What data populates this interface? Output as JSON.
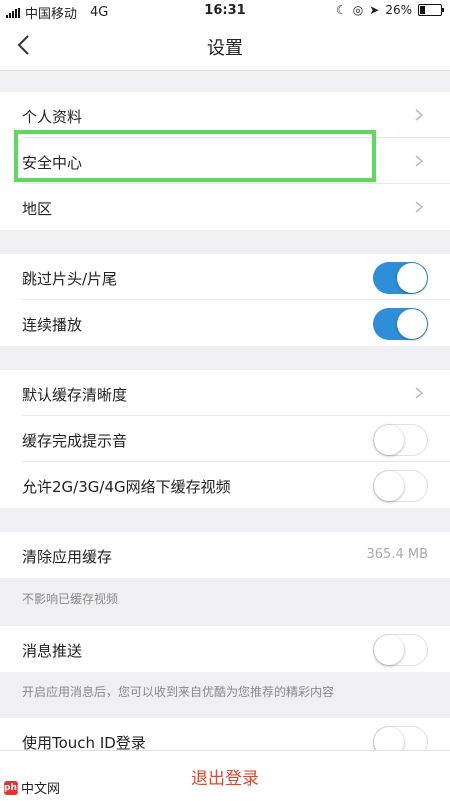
{
  "status_bar": {
    "carrier": "中国移动",
    "network": "4G",
    "time": "16:31",
    "battery": "26%"
  },
  "nav": {
    "title": "设置",
    "back_icon": "chevron-left-icon"
  },
  "sections": {
    "account": [
      "个人资料",
      "安全中心",
      "地区"
    ],
    "playback": [
      {
        "label": "跳过片头/片尾",
        "on": true
      },
      {
        "label": "连续播放",
        "on": true
      }
    ],
    "cache": {
      "default_quality": "默认缓存清晰度",
      "complete_sound": {
        "label": "缓存完成提示音",
        "on": false
      },
      "allow_mobile": {
        "label": "允许2G/3G/4G网络下缓存视频",
        "on": false
      }
    },
    "clear_cache": {
      "label": "清除应用缓存",
      "size": "365.4 MB",
      "note": "不影响已缓存视频"
    },
    "push": {
      "label": "消息推送",
      "on": false,
      "note": "开启应用消息后，您可以收到来自优酷为您推荐的精彩内容"
    },
    "touch_id": {
      "label": "使用Touch ID登录",
      "on": false
    }
  },
  "logout": "退出登录",
  "watermark": "中文网",
  "colors": {
    "toggle_on": "#2e8fd8",
    "logout_text": "#e0492b",
    "highlight": "#5fd85f"
  }
}
